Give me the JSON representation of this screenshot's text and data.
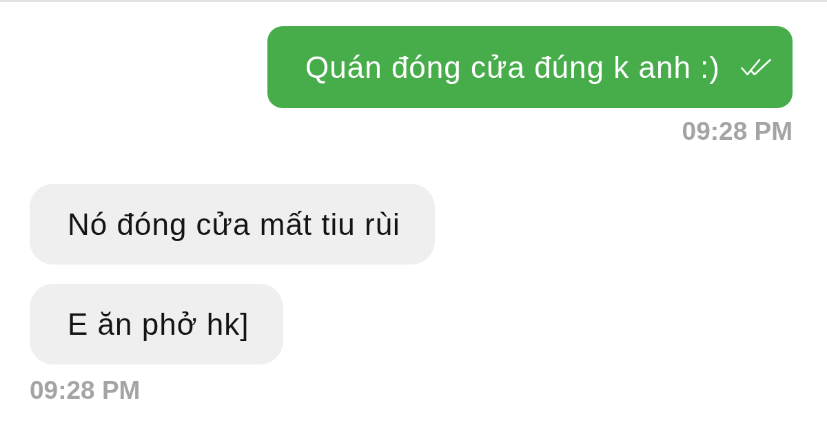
{
  "messages": [
    {
      "kind": "sent",
      "bubbles": [
        {
          "text": "Quán đóng cửa đúng k anh :)",
          "read": true
        }
      ],
      "time": "09:28 PM"
    },
    {
      "kind": "received",
      "bubbles": [
        {
          "text": "Nó đóng cửa mất tiu rùi"
        },
        {
          "text": "E ăn phở hk]"
        }
      ],
      "time": "09:28 PM"
    }
  ]
}
